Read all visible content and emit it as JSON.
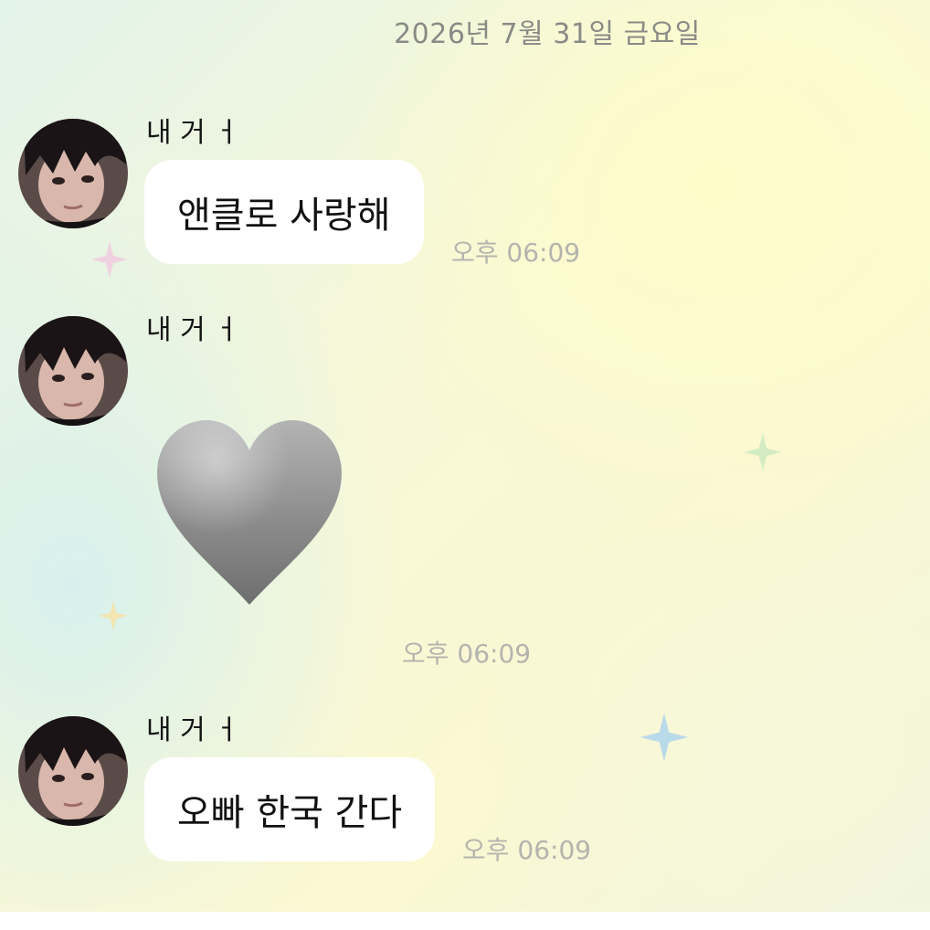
{
  "date_header": "2026년 7월 31일 금요일",
  "messages": [
    {
      "sender": "내 거 ㅓ",
      "type": "text",
      "text": "앤클로 사랑해",
      "time": "오후 06:09"
    },
    {
      "sender": "내 거 ㅓ",
      "type": "emoji",
      "emoji": "grey-heart-icon",
      "time": "오후 06:09"
    },
    {
      "sender": "내 거 ㅓ",
      "type": "text",
      "text": "오빠 한국 간다",
      "time": "오후 06:09"
    }
  ],
  "colors": {
    "bubble": "#ffffff",
    "timestamp": "#b4b4ae",
    "date_header": "#8a8a86",
    "heart": "#8c8c8c"
  }
}
